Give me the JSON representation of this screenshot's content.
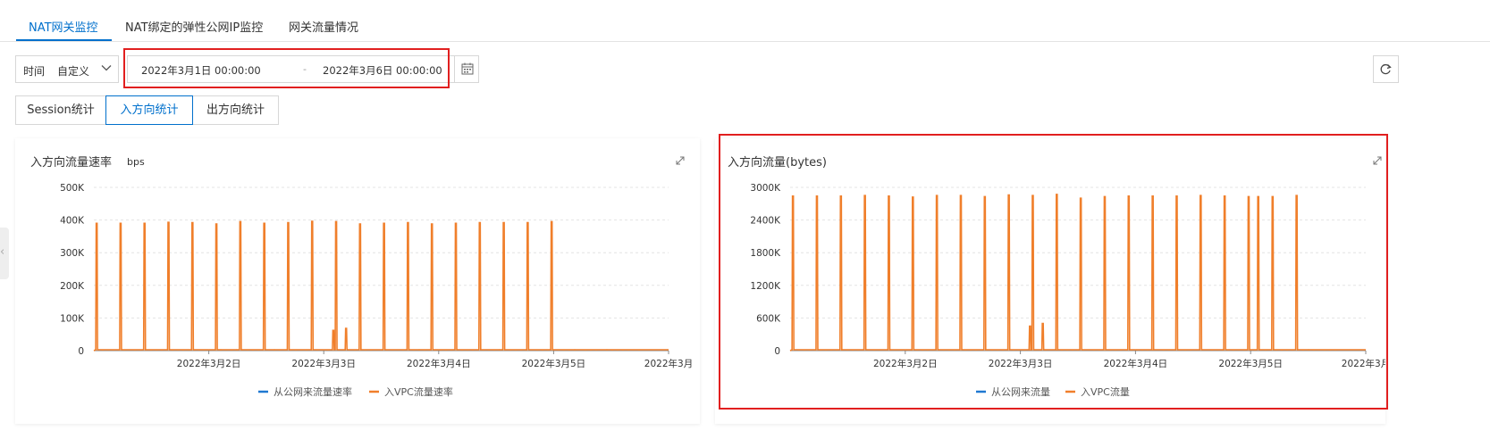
{
  "tabs": [
    {
      "label": "NAT网关监控",
      "active": true
    },
    {
      "label": "NAT绑定的弹性公网IP监控",
      "active": false
    },
    {
      "label": "网关流量情况",
      "active": false
    }
  ],
  "toolbar": {
    "time_label": "时间",
    "time_value": "自定义",
    "date_start": "2022年3月1日 00:00:00",
    "date_separator": "-",
    "date_end": "2022年3月6日 00:00:00"
  },
  "segments": [
    {
      "label": "Session统计",
      "active": false
    },
    {
      "label": "入方向统计",
      "active": true
    },
    {
      "label": "出方向统计",
      "active": false
    }
  ],
  "colors": {
    "accent": "#0070cc",
    "series_public": "#1f78d1",
    "series_vpc": "#f07f2b",
    "highlight": "#e11f1f"
  },
  "charts": [
    {
      "title": "入方向流量速率",
      "unit": "bps",
      "legend": [
        "从公网来流量速率",
        "入VPC流量速率"
      ]
    },
    {
      "title": "入方向流量(bytes)",
      "unit": "",
      "legend": [
        "从公网来流量",
        "入VPC流量"
      ]
    }
  ],
  "chart_data": [
    {
      "type": "line",
      "title": "入方向流量速率",
      "ylabel": "bps",
      "ylim": [
        0,
        500000
      ],
      "yticks": [
        "0",
        "100K",
        "200K",
        "300K",
        "400K",
        "500K"
      ],
      "xlim": [
        "2022-03-01 00:00",
        "2022-03-06 00:00"
      ],
      "xticks": [
        "2022年3月2日",
        "2022年3月3日",
        "2022年3月4日",
        "2022年3月5日",
        "2022年3月"
      ],
      "grid": true,
      "legend_position": "bottom",
      "series": [
        {
          "name": "从公网来流量速率",
          "values": []
        },
        {
          "name": "入VPC流量速率",
          "spike_times": [
            "2022-03-01 00:35",
            "2022-03-01 05:35",
            "2022-03-01 10:35",
            "2022-03-01 15:35",
            "2022-03-01 20:35",
            "2022-03-02 01:35",
            "2022-03-02 06:35",
            "2022-03-02 11:35",
            "2022-03-02 16:35",
            "2022-03-02 21:35",
            "2022-03-03 02:35",
            "2022-03-03 07:35",
            "2022-03-03 12:35",
            "2022-03-03 17:35",
            "2022-03-03 22:35",
            "2022-03-04 03:35",
            "2022-03-04 08:35",
            "2022-03-04 13:35",
            "2022-03-04 18:35",
            "2022-03-04 23:35"
          ],
          "spike_values": [
            390000,
            390000,
            390000,
            393000,
            392000,
            388000,
            395000,
            390000,
            392000,
            396000,
            395000,
            388000,
            390000,
            392000,
            388000,
            390000,
            392000,
            392000,
            392000,
            395000
          ],
          "extra_points": [
            [
              "2022-03-03 02:00",
              62000
            ],
            [
              "2022-03-03 04:40",
              68000
            ]
          ],
          "baseline": 5000
        }
      ]
    },
    {
      "type": "line",
      "title": "入方向流量(bytes)",
      "ylabel": "",
      "ylim": [
        0,
        3000000
      ],
      "yticks": [
        "0",
        "600K",
        "1200K",
        "1800K",
        "2400K",
        "3000K"
      ],
      "xlim": [
        "2022-03-01 00:00",
        "2022-03-06 00:00"
      ],
      "xticks": [
        "2022年3月2日",
        "2022年3月3日",
        "2022年3月4日",
        "2022年3月5日",
        "2022年3月"
      ],
      "grid": true,
      "legend_position": "bottom",
      "series": [
        {
          "name": "从公网来流量",
          "values": []
        },
        {
          "name": "入VPC流量",
          "spike_times": [
            "2022-03-01 00:35",
            "2022-03-01 05:35",
            "2022-03-01 10:35",
            "2022-03-01 15:35",
            "2022-03-01 20:35",
            "2022-03-02 01:35",
            "2022-03-02 06:35",
            "2022-03-02 11:35",
            "2022-03-02 16:35",
            "2022-03-02 21:35",
            "2022-03-03 02:35",
            "2022-03-03 07:35",
            "2022-03-03 12:35",
            "2022-03-03 17:35",
            "2022-03-03 22:35",
            "2022-03-04 03:35",
            "2022-03-04 08:35",
            "2022-03-04 13:35",
            "2022-03-04 18:35",
            "2022-03-04 23:35",
            "2022-03-05 01:35",
            "2022-03-05 04:35",
            "2022-03-05 09:35"
          ],
          "spike_values": [
            2840000,
            2840000,
            2840000,
            2850000,
            2840000,
            2820000,
            2850000,
            2850000,
            2830000,
            2860000,
            2850000,
            2870000,
            2800000,
            2830000,
            2840000,
            2840000,
            2840000,
            2850000,
            2840000,
            2830000,
            2830000,
            2830000,
            2850000
          ],
          "extra_points": [
            [
              "2022-03-03 02:00",
              450000
            ],
            [
              "2022-03-03 04:40",
              500000
            ]
          ],
          "baseline": 30000
        }
      ]
    }
  ]
}
